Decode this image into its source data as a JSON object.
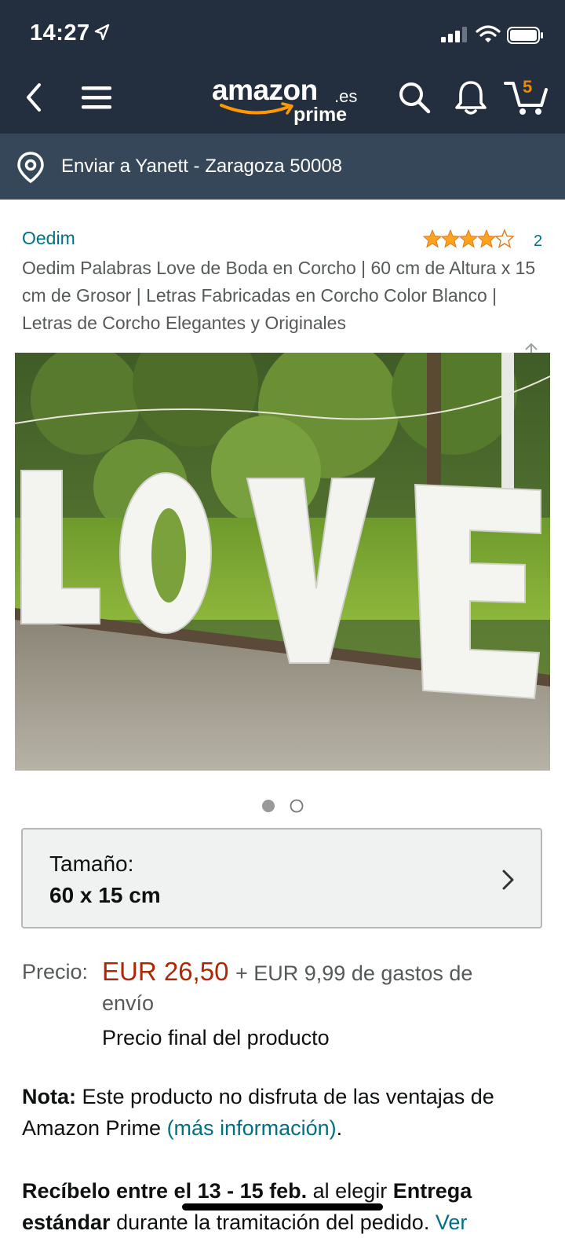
{
  "status_bar": {
    "time": "14:27"
  },
  "header": {
    "logo_word": "amazon",
    "logo_tld": ".es",
    "logo_sub": "prime",
    "cart_count": "5"
  },
  "delivery": {
    "text": "Enviar a Yanett - Zaragoza 50008"
  },
  "product": {
    "brand": "Oedim",
    "rating_stars": 4,
    "rating_count": "2",
    "title": "Oedim Palabras Love de Boda en Corcho | 60 cm de Altura x 15 cm de Grosor | Letras Fabricadas en Corcho Color Blanco | Letras de Corcho Elegantes y Originales",
    "image_count": 2,
    "image_active": 1
  },
  "size_selector": {
    "label": "Tamaño:",
    "value": "60 x 15 cm"
  },
  "price": {
    "label": "Precio:",
    "amount": "EUR 26,50",
    "shipping": "+ EUR 9,99 de gastos de",
    "shipping_cont": "envío",
    "final_note": "Precio final del producto"
  },
  "note": {
    "bold": "Nota:",
    "text": " Este producto no disfruta de las ventajas de Amazon Prime ",
    "link": "(más información)",
    "end": "."
  },
  "delivery_estimate": {
    "bold1": "Recíbelo entre el 13 - 15 feb.",
    "text1": " al elegir ",
    "bold2": "Entrega",
    "bold3": "estándar",
    "text2": " durante la tramitación del pedido. ",
    "link": "Ver"
  },
  "colors": {
    "header": "#232f3e",
    "subheader": "#37475a",
    "link": "#007185",
    "price": "#b12704",
    "accent": "#f08804"
  }
}
